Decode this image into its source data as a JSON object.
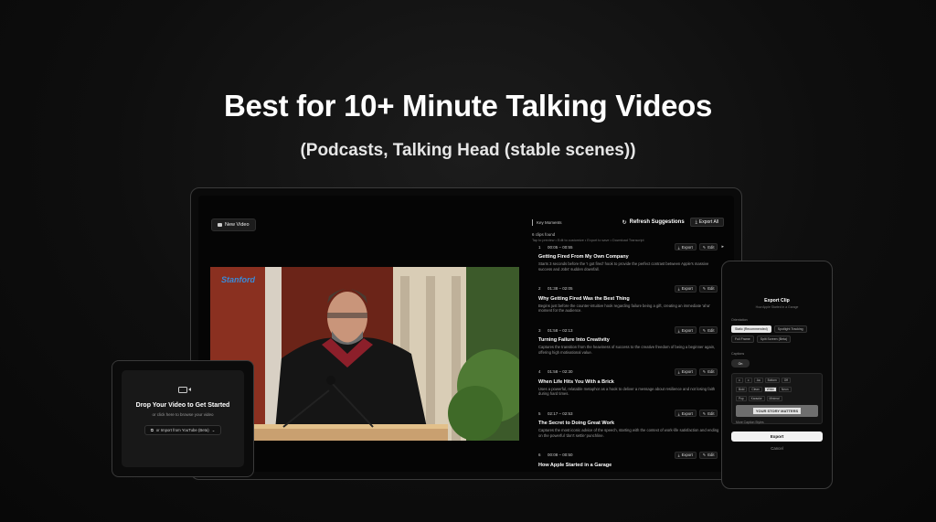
{
  "hero": {
    "headline": "Best for 10+ Minute Talking Videos",
    "subheadline": "(Podcasts, Talking Head (stable scenes))"
  },
  "app": {
    "new_video_label": "New Video",
    "video_logo": "Stanford"
  },
  "panel": {
    "title": "Key Moments",
    "refresh_label": "Refresh Suggestions",
    "export_all_label": "Export All",
    "clips_found": "6 clips found",
    "tips": "Tap to preview • Edit to customize • Export to save • Download Transcript",
    "export_label": "Export",
    "edit_label": "Edit",
    "clips": [
      {
        "num": "1",
        "time": "00:05 – 00:55",
        "title": "Getting Fired From My Own Company",
        "desc": "Starts 3 seconds before the 'I got fired' hook to provide the perfect contrast between Apple's massive success and Jobs' sudden downfall."
      },
      {
        "num": "2",
        "time": "01:38 – 02:05",
        "title": "Why Getting Fired Was the Best Thing",
        "desc": "Begins just before the counter-intuitive hook regarding failure being a gift, creating an immediate 'aha' moment for the audience."
      },
      {
        "num": "3",
        "time": "01:58 – 02:13",
        "title": "Turning Failure Into Creativity",
        "desc": "Captures the transition from the heaviness of success to the creative freedom of being a beginner again, offering high motivational value."
      },
      {
        "num": "4",
        "time": "01:58 – 02:30",
        "title": "When Life Hits You With a Brick",
        "desc": "Uses a powerful, relatable metaphor as a hook to deliver a message about resilience and not losing faith during hard times."
      },
      {
        "num": "5",
        "time": "02:17 – 02:53",
        "title": "The Secret to Doing Great Work",
        "desc": "Captures the most iconic advice of the speech, starting with the context of work-life satisfaction and ending on the powerful 'don't settle' punchline."
      },
      {
        "num": "6",
        "time": "00:08 – 00:50",
        "title": "How Apple Started in a Garage",
        "desc": ""
      }
    ]
  },
  "upload": {
    "title": "Drop Your Video to Get Started",
    "subtitle": "or click here to browse your video",
    "import_label": "or Import from YouTube (Beta)"
  },
  "export_clip": {
    "title": "Export Clip",
    "subtitle": "How Apple Started in a Garage",
    "orientation_label": "Orientation",
    "layout_options": [
      "Static (Recommended)",
      "Spotlight Tracking",
      "Full Frame",
      "Split Screen (Beta)"
    ],
    "captions_label": "Captions",
    "captions_toggle": "On",
    "caption_tools": [
      "≡",
      "≡",
      "Aa",
      "Bottom",
      "Off"
    ],
    "caption_styles": [
      "Bold",
      "Clean",
      "White",
      "Neon",
      "Pop",
      "Karaoke",
      "Minimal"
    ],
    "caption_preview": "YOUR STORY MATTERS",
    "more_styles": "More Caption Styles",
    "export_label": "Export",
    "cancel_label": "Cancel"
  }
}
